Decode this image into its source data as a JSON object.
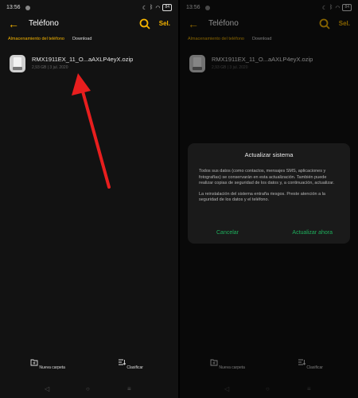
{
  "status": {
    "time": "13:56",
    "battery": "84"
  },
  "header": {
    "title": "Teléfono",
    "select_label": "Sel."
  },
  "breadcrumbs": {
    "storage": "Almacenamiento del teléfono",
    "folder": "Download"
  },
  "file": {
    "name": "RMX1911EX_11_O...aAXLP4eyX.ozip",
    "meta": "2,93 GB | 3 jul. 2020"
  },
  "bottom_bar": {
    "new_folder": "Nueva carpeta",
    "sort": "Clasificar"
  },
  "dialog": {
    "title": "Actualizar sistema",
    "paragraph1": "Todos sus datos (como contactos, mensajes SMS, aplicaciones y fotografías) se conservarán en esta actualización. También puede realizar copias de seguridad de los datos y, a continuación, actualizar.",
    "paragraph2": "La reinstalación del sistema entraña riesgos. Preste atención a la seguridad de los datos y el teléfono.",
    "cancel": "Cancelar",
    "confirm": "Actualizar ahora"
  },
  "colors": {
    "accent": "#f5b400",
    "dialog_action": "#1eae5c",
    "arrow": "#e81e1e"
  }
}
